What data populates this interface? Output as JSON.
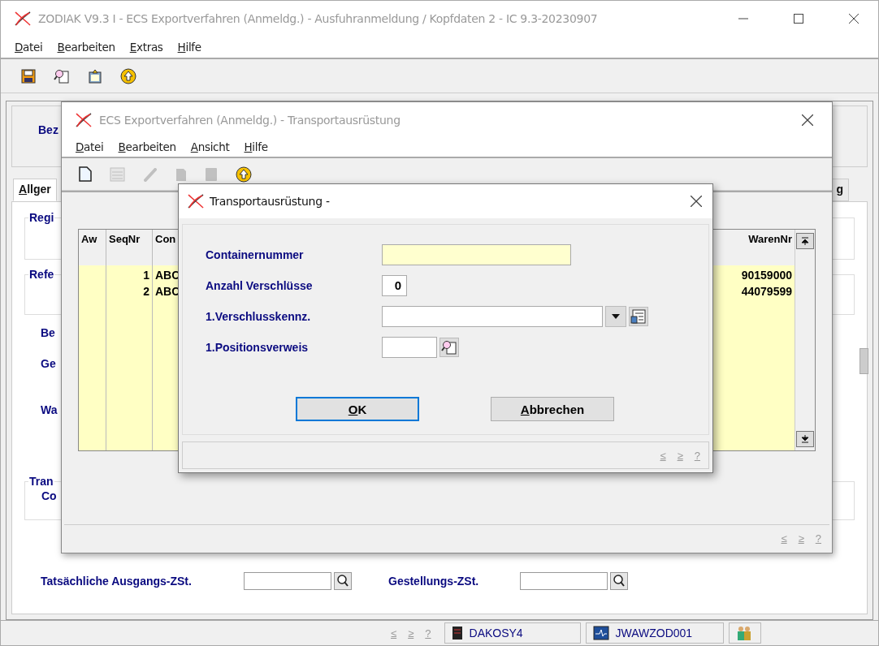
{
  "main_window": {
    "title": "ZODIAK V9.3 I - ECS Exportverfahren (Anmeldg.) - Ausfuhranmeldung / Kopfdaten 2 - IC 9.3-20230907",
    "menu": [
      "Datei",
      "Bearbeiten",
      "Extras",
      "Hilfe"
    ],
    "toolbar": [
      {
        "kind": "save",
        "disabled": false
      },
      {
        "kind": "search",
        "disabled": false
      },
      {
        "kind": "clipboard",
        "disabled": false
      },
      {
        "kind": "upload",
        "disabled": false
      }
    ],
    "form": {
      "header_label": "Bez",
      "tabs": [
        {
          "label": "Allger",
          "selected": true
        },
        {
          "label": "g",
          "selected": false
        }
      ],
      "groups": [
        {
          "label": "Regi"
        },
        {
          "label": "Refe"
        }
      ],
      "field_labels": [
        "Be",
        "Ge",
        "Wa"
      ],
      "transport_group": {
        "label": "Tran",
        "field_label": "Co"
      },
      "office_fields": [
        {
          "label": "Tatsächliche Ausgangs-ZSt."
        },
        {
          "label": "Gestellungs-ZSt."
        }
      ]
    },
    "status_bar": {
      "nav": [
        "≤",
        "≥",
        "?"
      ],
      "panels": [
        {
          "kind": "server",
          "text": "DAKOSY4"
        },
        {
          "kind": "monitor",
          "text": "JWAWZOD001"
        },
        {
          "kind": "users"
        }
      ]
    }
  },
  "child_window": {
    "title": "ECS Exportverfahren (Anmeldg.) - Transportausrüstung",
    "menu": [
      "Datei",
      "Bearbeiten",
      "Ansicht",
      "Hilfe"
    ],
    "toolbar": [
      {
        "kind": "new",
        "disabled": false
      },
      {
        "kind": "grid",
        "disabled": true
      },
      {
        "kind": "pencil",
        "disabled": true
      },
      {
        "kind": "page",
        "disabled": true
      },
      {
        "kind": "block",
        "disabled": true
      },
      {
        "kind": "upload",
        "disabled": false
      }
    ],
    "table": {
      "columns": [
        "Aw",
        "SeqNr",
        "Con",
        "WarenNr"
      ],
      "rows": [
        {
          "cells": [
            "",
            "1",
            "ABC",
            "90159000"
          ]
        },
        {
          "cells": [
            "",
            "2",
            "ABC",
            "44079599"
          ]
        }
      ]
    },
    "status_bar": {
      "nav": [
        "≤",
        "≥",
        "?"
      ]
    }
  },
  "dialog": {
    "title": "Transportausrüstung -",
    "fields": [
      {
        "label": "Containernummer",
        "kind": "text",
        "mandatory": true
      },
      {
        "label": "Anzahl Verschlüsse",
        "kind": "number",
        "value": "0",
        "mandatory": false
      },
      {
        "label": "1.Verschlusskennz.",
        "kind": "combo",
        "mandatory": false
      },
      {
        "label": "1.Positionsverweis",
        "kind": "lookup",
        "mandatory": false
      }
    ],
    "buttons": [
      {
        "label": "OK",
        "focused": true
      },
      {
        "label": "Abbrechen",
        "focused": false
      }
    ],
    "status_bar": {
      "nav": [
        "≤",
        "≥",
        "?"
      ]
    }
  }
}
